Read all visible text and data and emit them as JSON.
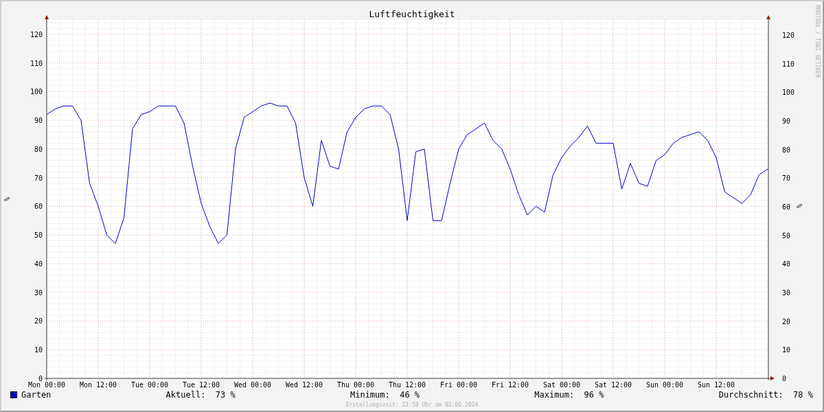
{
  "credit": "RRDTOOL / TOBI OETIKER",
  "graph": {
    "chart_data": {
      "type": "line",
      "grid": true,
      "title": "Luftfeuchtigkeit",
      "ylabel": "%",
      "ylim": [
        0,
        125
      ],
      "yticks": [
        0,
        10,
        20,
        30,
        40,
        50,
        60,
        70,
        80,
        90,
        100,
        110,
        120
      ],
      "categories": [
        "Mon 00:00",
        null,
        null,
        null,
        null,
        null,
        "Mon 12:00",
        null,
        null,
        null,
        null,
        null,
        "Tue 00:00",
        null,
        null,
        null,
        null,
        null,
        "Tue 12:00",
        null,
        null,
        null,
        null,
        null,
        "Wed 00:00",
        null,
        null,
        null,
        null,
        null,
        "Wed 12:00",
        null,
        null,
        null,
        null,
        null,
        "Thu 00:00",
        null,
        null,
        null,
        null,
        null,
        "Thu 12:00",
        null,
        null,
        null,
        null,
        null,
        "Fri 00:00",
        null,
        null,
        null,
        null,
        null,
        "Fri 12:00",
        null,
        null,
        null,
        null,
        null,
        "Sat 00:00",
        null,
        null,
        null,
        null,
        null,
        "Sat 12:00",
        null,
        null,
        null,
        null,
        null,
        "Sun 00:00",
        null,
        null,
        null,
        null,
        null,
        "Sun 12:00",
        null,
        null,
        null,
        null,
        null,
        null
      ],
      "series": [
        {
          "name": "Garten",
          "color": "#0000cc",
          "values": [
            92,
            94,
            95,
            95,
            90,
            68,
            60,
            50,
            47,
            56,
            87,
            92,
            93,
            95,
            95,
            95,
            89,
            74,
            61,
            53,
            47,
            50,
            80,
            91,
            93,
            95,
            96,
            95,
            95,
            89,
            70,
            60,
            83,
            74,
            73,
            86,
            91,
            94,
            95,
            95,
            92,
            80,
            55,
            79,
            80,
            55,
            55,
            68,
            80,
            85,
            87,
            89,
            83,
            80,
            73,
            64,
            57,
            60,
            58,
            71,
            77,
            81,
            84,
            88,
            82,
            82,
            82,
            66,
            75,
            68,
            67,
            76,
            78,
            82,
            84,
            85,
            86,
            83,
            77,
            65,
            63,
            61,
            64,
            71,
            73
          ]
        }
      ]
    },
    "right_axis": {
      "label": "%",
      "ticks": [
        "120",
        "110",
        "100",
        "90",
        "80",
        "70",
        "60",
        "50",
        "40",
        "30",
        "20",
        "10",
        "0"
      ]
    }
  },
  "legend": {
    "stats": [
      "Aktuell:  73 %",
      "Minimum:  46 %",
      "Maximum:  96 %",
      "Durchschnitt:  78 %"
    ]
  },
  "footer": "Erstellungszeit: 23:58 Uhr am 02.06.2024"
}
